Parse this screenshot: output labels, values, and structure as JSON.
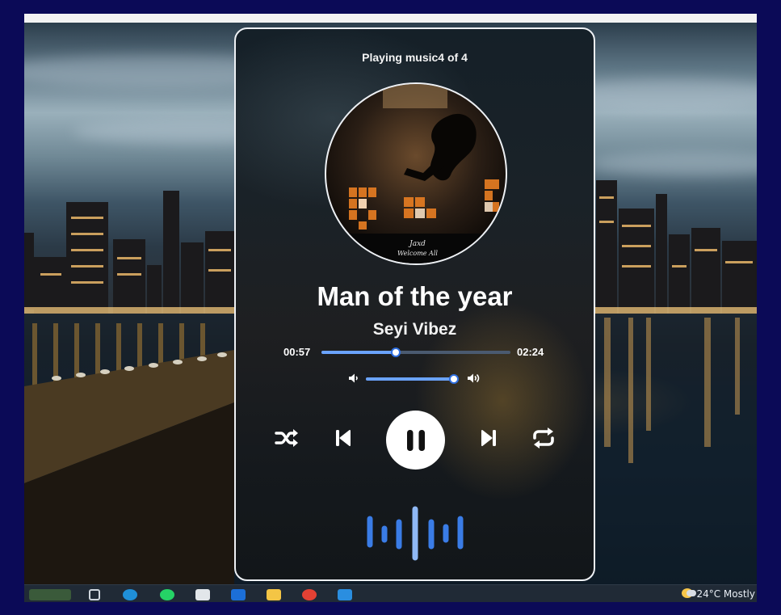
{
  "player": {
    "status": "Playing music4 of 4",
    "title": "Man of the year",
    "artist": "Seyi Vibez",
    "current_time": "00:57",
    "total_time": "02:24",
    "progress_fraction": 0.395,
    "volume_fraction": 0.97,
    "state": "playing",
    "accent_color": "#6aa3ff",
    "controls": {
      "shuffle": "shuffle-icon",
      "previous": "skip-previous-icon",
      "pause": "pause-icon",
      "next": "skip-next-icon",
      "repeat": "repeat-icon"
    }
  },
  "taskbar": {
    "weather": "24°C  Mostly"
  }
}
